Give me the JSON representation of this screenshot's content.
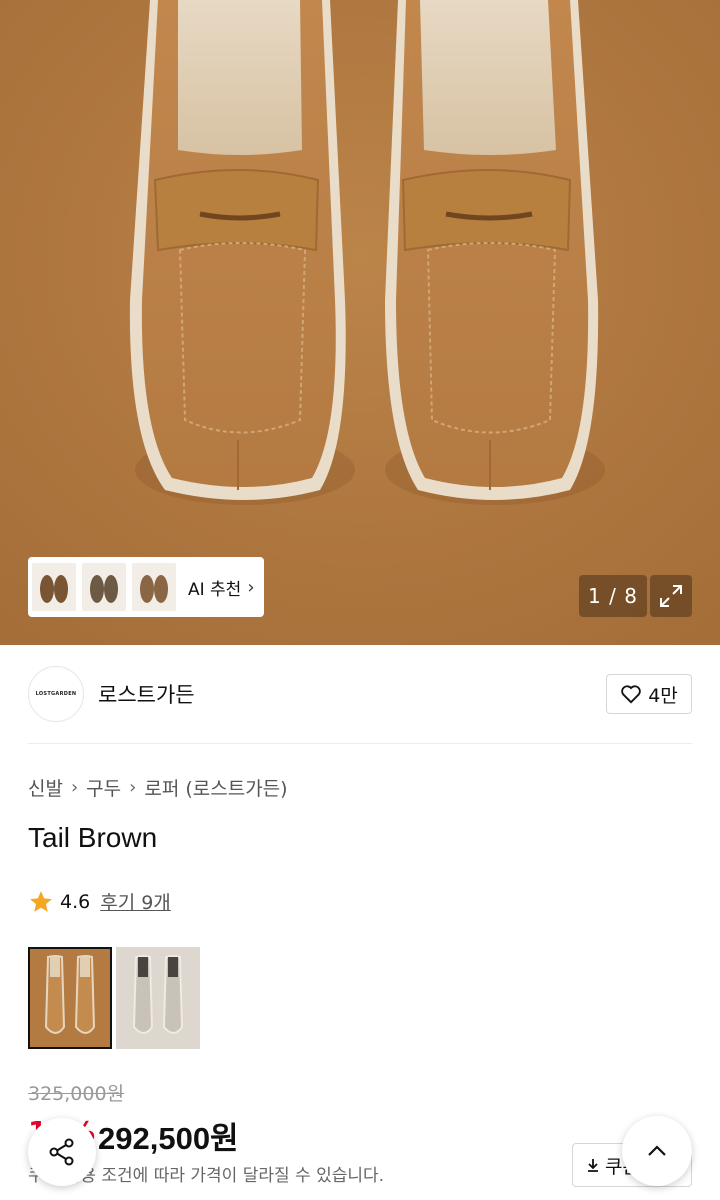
{
  "gallery": {
    "ai_label": "AI 추천",
    "counter": "1 / 8",
    "bg_color": "#b37a42"
  },
  "brand": {
    "logo_text": "LOSTGARDEN",
    "name": "로스트가든",
    "likes": "4만"
  },
  "breadcrumb": [
    "신발",
    "구두",
    "로퍼 (로스트가든)"
  ],
  "product": {
    "title": "Tail Brown",
    "rating": "4.6",
    "reviews": "후기 9개"
  },
  "colors": [
    {
      "name": "tail-brown",
      "selected": true,
      "hex": "#b37a42"
    },
    {
      "name": "grey",
      "selected": false,
      "hex": "#c9c2b8"
    }
  ],
  "pricing": {
    "original": "325,000원",
    "discount": "10%",
    "price": "292,500원",
    "note": "쿠폰 적용 조건에 따라 가격이 달라질 수 있습니다.",
    "coupon_label": "쿠폰"
  },
  "icons": {
    "share": "share-icon",
    "top": "chevron-up-icon",
    "expand": "expand-icon",
    "heart": "heart-icon",
    "star": "star-icon",
    "download": "download-icon"
  },
  "accent_colors": {
    "discount_red": "#e6002d",
    "star_orange": "#f5a623"
  }
}
